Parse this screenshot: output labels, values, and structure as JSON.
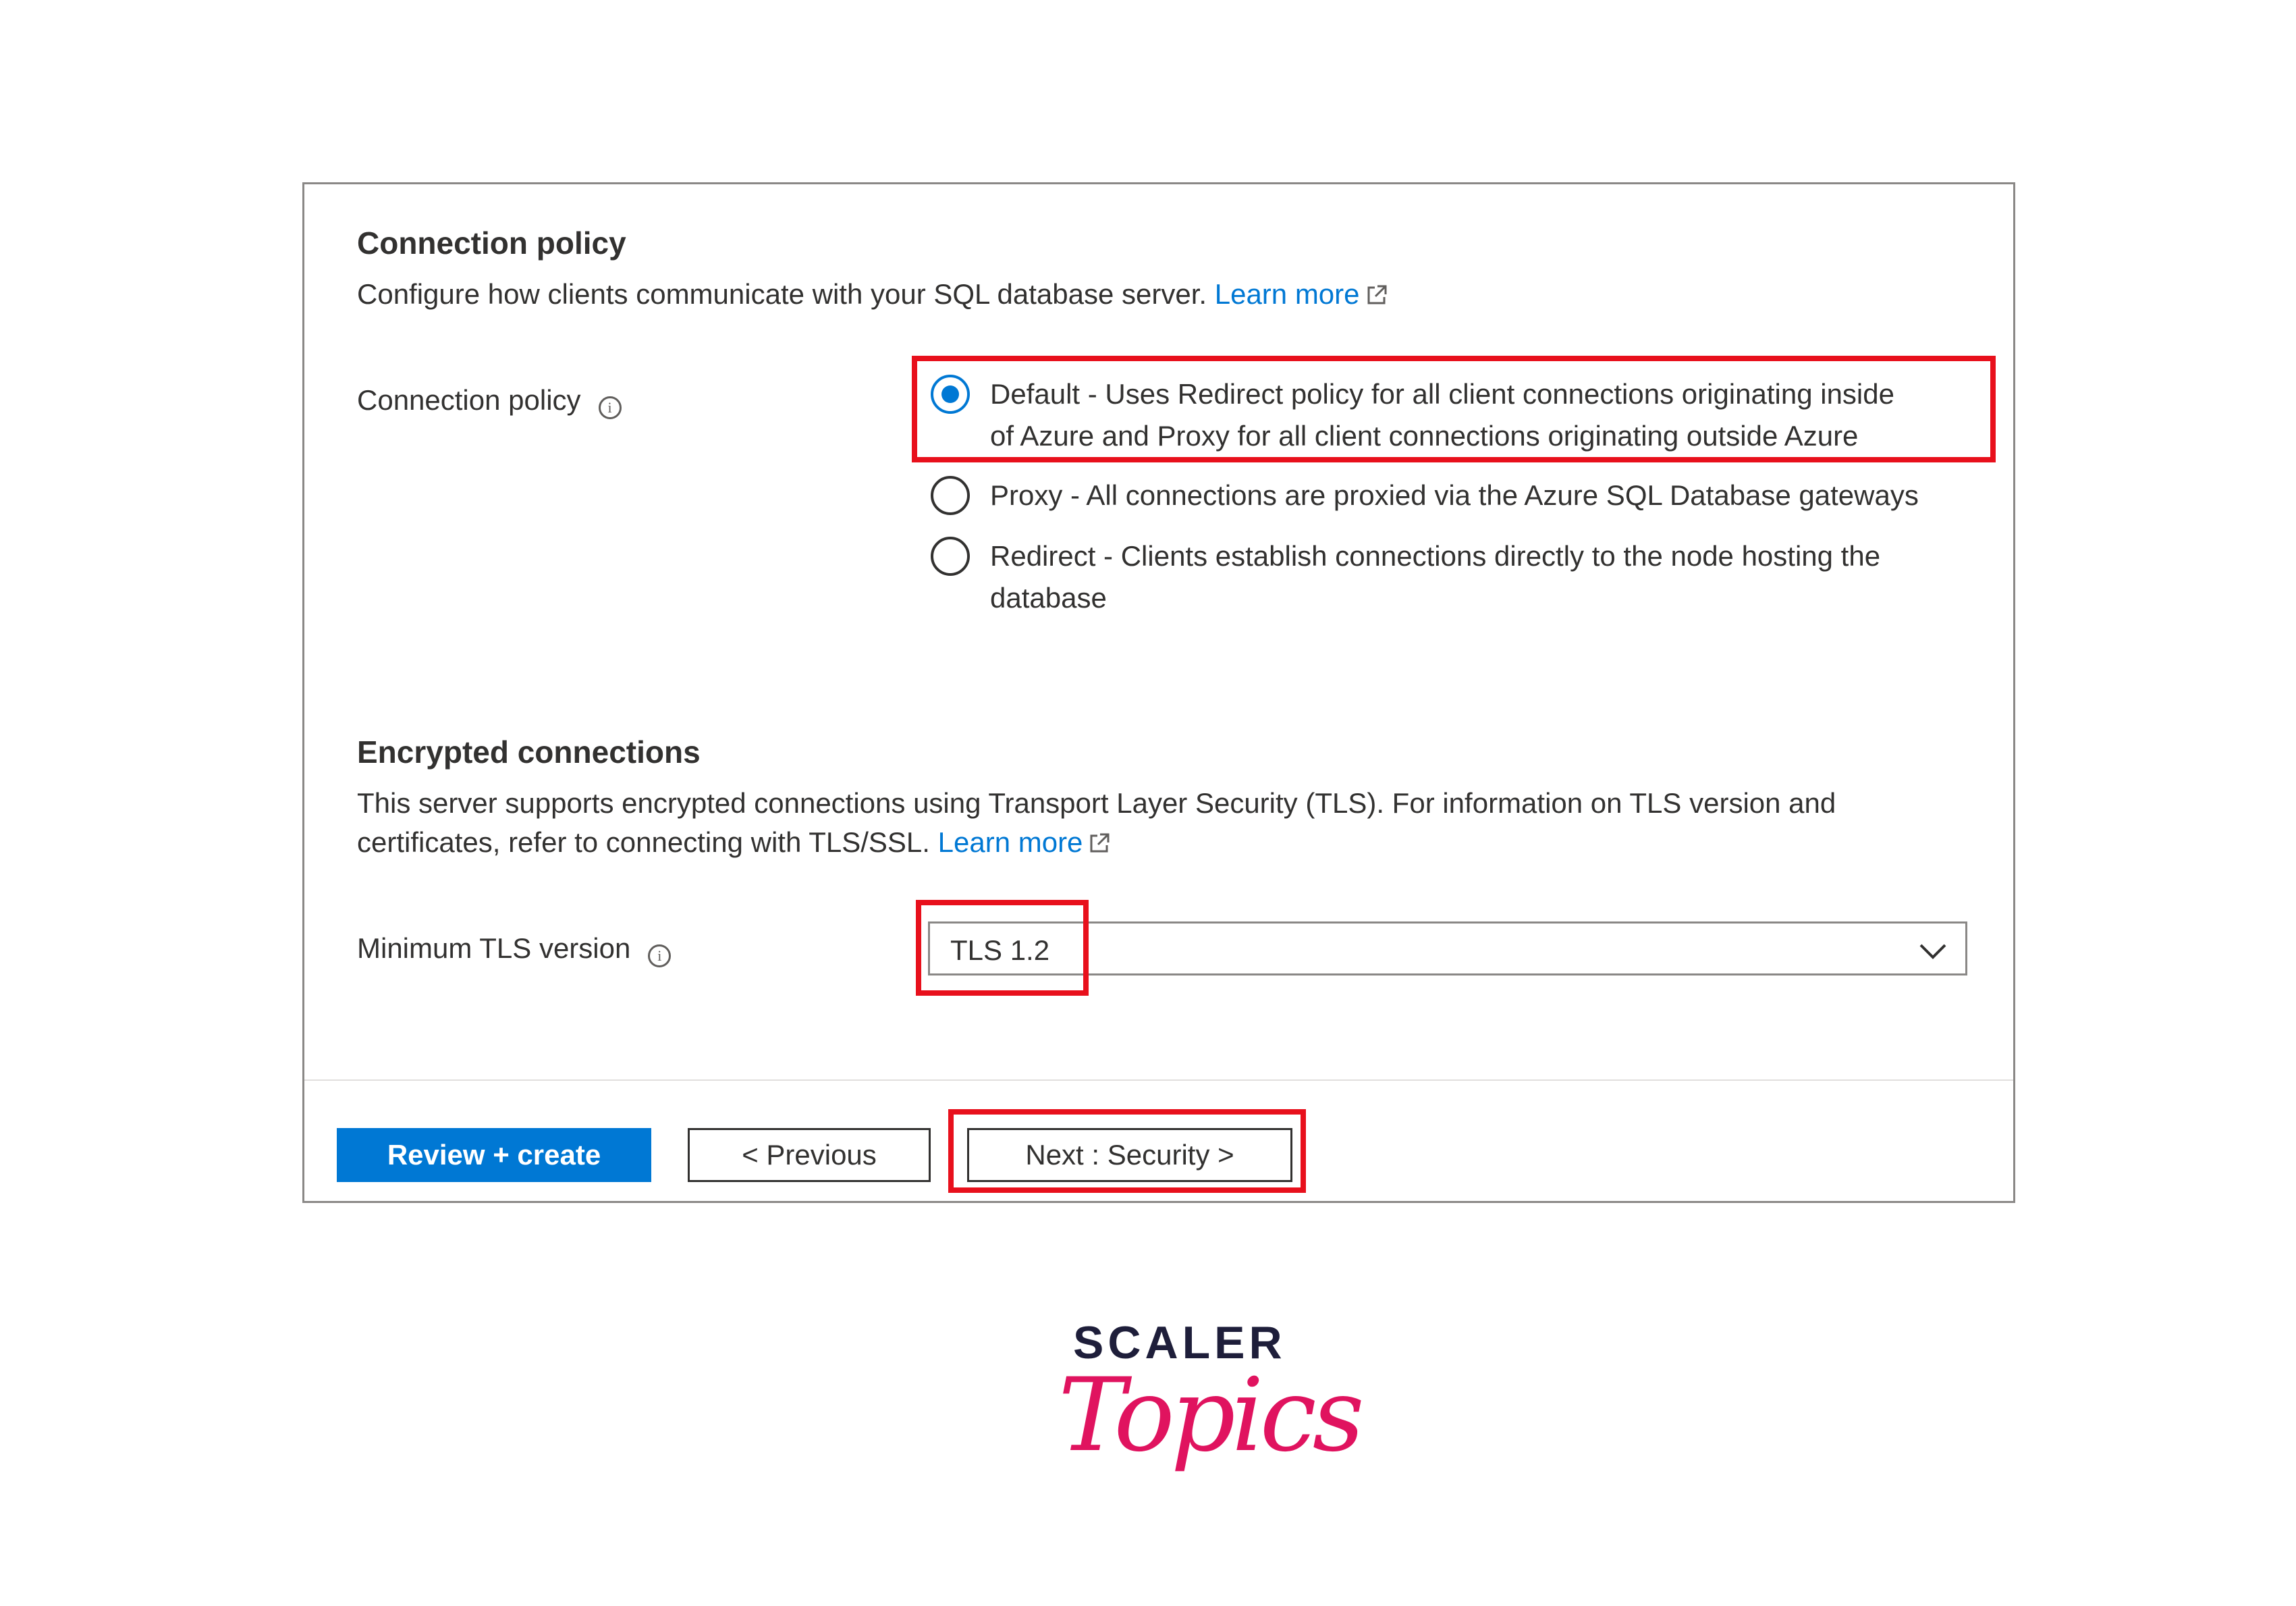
{
  "connection_section": {
    "title": "Connection policy",
    "description": "Configure how clients communicate with your SQL database server.",
    "learn_more": "Learn more"
  },
  "connection_policy": {
    "label": "Connection policy",
    "info": "i",
    "options": [
      {
        "line1": "Default - Uses Redirect policy for all client connections originating inside",
        "line2": "of Azure and Proxy for all client connections originating outside Azure",
        "checked": true
      },
      {
        "line1": "Proxy - All connections are proxied via the Azure SQL Database gateways",
        "line2": "",
        "checked": false
      },
      {
        "line1": "Redirect - Clients establish connections directly to the node hosting the",
        "line2": "database",
        "checked": false
      }
    ]
  },
  "encrypted_section": {
    "title": "Encrypted connections",
    "line1": "This server supports encrypted connections using Transport Layer Security (TLS). For information on TLS version and",
    "line2": "certificates, refer to connecting with TLS/SSL.",
    "learn_more": "Learn more"
  },
  "tls": {
    "label": "Minimum TLS version",
    "info": "i",
    "value": "TLS 1.2"
  },
  "footer": {
    "review_create": "Review + create",
    "previous": "< Previous",
    "next": "Next : Security >"
  },
  "logo": {
    "line1": "SCALER",
    "line2": "Topics"
  },
  "colors": {
    "accent": "#0078d4",
    "highlight": "#e8101c",
    "logo_pink": "#e0135f",
    "logo_navy": "#1e1e3a"
  }
}
